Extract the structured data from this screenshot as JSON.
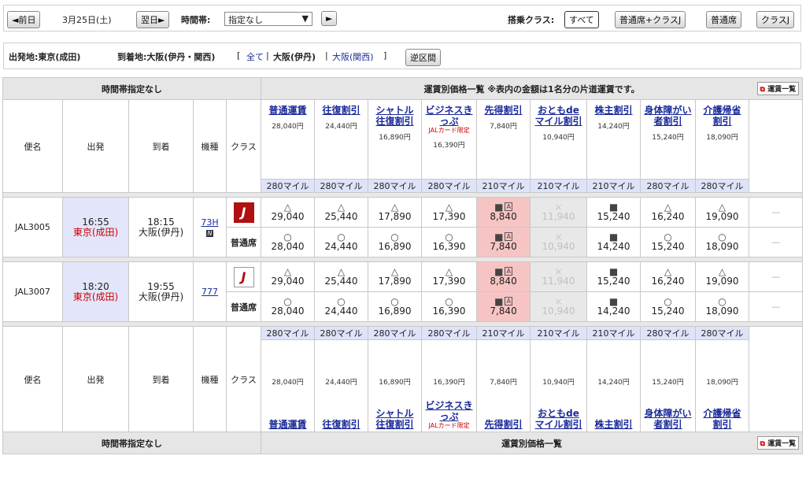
{
  "toolbar": {
    "prev_day": "◄前日",
    "date": "3月25日(土)",
    "next_day": "翌日►",
    "time_band_label": "時間帯:",
    "time_band_value": "指定なし",
    "go": "►",
    "class_label": "搭乗クラス:",
    "class_buttons": [
      "すべて",
      "普通席+クラスJ",
      "普通席",
      "クラスJ"
    ]
  },
  "route": {
    "origin": "出発地:東京(成田)",
    "dest_label": "到着地:大阪(伊丹・関西)",
    "bracket_open": "[",
    "all": "全て",
    "sep": "|",
    "itami": "大阪(伊丹)",
    "kansai": "大阪(関西)",
    "bracket_close": "]",
    "reverse_button": "逆区間"
  },
  "table": {
    "time_band_none": "時間帯指定なし",
    "fare_list_header": "運賃別価格一覧 ※表内の金額は1名分の片道運賃です。",
    "fare_list_footer": "運賃別価格一覧",
    "fare_list_link": "運賃一覧",
    "col_flight": "便名",
    "col_departure": "出発",
    "col_arrival": "到着",
    "col_aircraft": "機種",
    "col_class": "クラス",
    "fares": [
      {
        "name1": "普通運賃",
        "name2": "",
        "note": "",
        "price": "28,040円",
        "miles": "280マイル"
      },
      {
        "name1": "往復割引",
        "name2": "",
        "note": "",
        "price": "24,440円",
        "miles": "280マイル"
      },
      {
        "name1": "シャトル",
        "name2": "往復割引",
        "note": "",
        "price": "16,890円",
        "miles": "280マイル"
      },
      {
        "name1": "ビジネスきっぷ",
        "name2": "",
        "note": "JALカード限定",
        "price": "16,390円",
        "miles": "280マイル"
      },
      {
        "name1": "先得割引",
        "name2": "",
        "note": "",
        "price": "7,840円",
        "miles": "210マイル"
      },
      {
        "name1": "おともde",
        "name2": "マイル割引",
        "note": "",
        "price": "10,940円",
        "miles": "210マイル"
      },
      {
        "name1": "株主割引",
        "name2": "",
        "note": "",
        "price": "14,240円",
        "miles": "210マイル"
      },
      {
        "name1": "身体障がい",
        "name2": "者割引",
        "note": "",
        "price": "15,240円",
        "miles": "280マイル"
      },
      {
        "name1": "介護帰省",
        "name2": "割引",
        "note": "",
        "price": "18,090円",
        "miles": "280マイル"
      }
    ],
    "flights": [
      {
        "number": "JAL3005",
        "dep_time": "16:55",
        "dep_airport": "東京(成田)",
        "arr_time": "18:15",
        "arr_airport": "大阪(伊丹)",
        "aircraft": "73H",
        "aircraft_badge": "N",
        "class_label": "普通席",
        "row1": [
          {
            "sym": "△",
            "val": "29,040",
            "state": "n"
          },
          {
            "sym": "△",
            "val": "25,440",
            "state": "n"
          },
          {
            "sym": "△",
            "val": "17,890",
            "state": "n"
          },
          {
            "sym": "△",
            "val": "17,390",
            "state": "n"
          },
          {
            "sym": "■",
            "val": "8,840",
            "state": "p"
          },
          {
            "sym": "×",
            "val": "11,940",
            "state": "g"
          },
          {
            "sym": "■",
            "val": "15,240",
            "state": "n"
          },
          {
            "sym": "△",
            "val": "16,240",
            "state": "n"
          },
          {
            "sym": "△",
            "val": "19,090",
            "state": "n"
          }
        ],
        "row2": [
          {
            "sym": "○",
            "val": "28,040",
            "state": "n"
          },
          {
            "sym": "○",
            "val": "24,440",
            "state": "n"
          },
          {
            "sym": "○",
            "val": "16,890",
            "state": "n"
          },
          {
            "sym": "○",
            "val": "16,390",
            "state": "n"
          },
          {
            "sym": "■",
            "val": "7,840",
            "state": "p"
          },
          {
            "sym": "×",
            "val": "10,940",
            "state": "g"
          },
          {
            "sym": "■",
            "val": "14,240",
            "state": "n"
          },
          {
            "sym": "○",
            "val": "15,240",
            "state": "n"
          },
          {
            "sym": "○",
            "val": "18,090",
            "state": "n"
          }
        ]
      },
      {
        "number": "JAL3007",
        "dep_time": "18:20",
        "dep_airport": "東京(成田)",
        "arr_time": "19:55",
        "arr_airport": "大阪(伊丹)",
        "aircraft": "777",
        "aircraft_badge": "",
        "class_label": "普通席",
        "row1": [
          {
            "sym": "△",
            "val": "29,040",
            "state": "n"
          },
          {
            "sym": "△",
            "val": "25,440",
            "state": "n"
          },
          {
            "sym": "△",
            "val": "17,890",
            "state": "n"
          },
          {
            "sym": "△",
            "val": "17,390",
            "state": "n"
          },
          {
            "sym": "■",
            "val": "8,840",
            "state": "p"
          },
          {
            "sym": "×",
            "val": "11,940",
            "state": "g"
          },
          {
            "sym": "■",
            "val": "15,240",
            "state": "n"
          },
          {
            "sym": "△",
            "val": "16,240",
            "state": "n"
          },
          {
            "sym": "△",
            "val": "19,090",
            "state": "n"
          }
        ],
        "row2": [
          {
            "sym": "○",
            "val": "28,040",
            "state": "n"
          },
          {
            "sym": "○",
            "val": "24,440",
            "state": "n"
          },
          {
            "sym": "○",
            "val": "16,890",
            "state": "n"
          },
          {
            "sym": "○",
            "val": "16,390",
            "state": "n"
          },
          {
            "sym": "■",
            "val": "7,840",
            "state": "p"
          },
          {
            "sym": "×",
            "val": "10,940",
            "state": "g"
          },
          {
            "sym": "■",
            "val": "14,240",
            "state": "n"
          },
          {
            "sym": "○",
            "val": "15,240",
            "state": "n"
          },
          {
            "sym": "○",
            "val": "18,090",
            "state": "n"
          }
        ]
      }
    ],
    "a_mark": "A",
    "dash": "—"
  },
  "colors": {
    "accent_red": "#cc0000",
    "header_blue": "#dfe3fa",
    "pink": "#f7c4c4"
  }
}
